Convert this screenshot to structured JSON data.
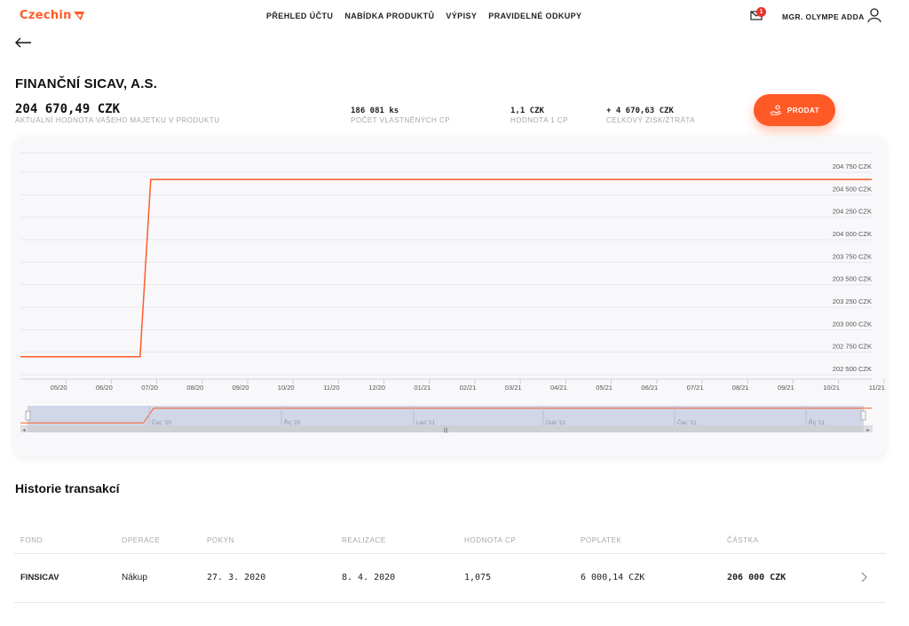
{
  "brand": {
    "name": "Czechin",
    "accent": "#ff5a26"
  },
  "nav": {
    "items": [
      "PŘEHLED ÚČTU",
      "NABÍDKA PRODUKTŮ",
      "VÝPISY",
      "PRAVIDELNÉ ODKUPY"
    ]
  },
  "header": {
    "mail_badge": "1",
    "user_name": "MGR. OLYMPE ADDA",
    "icons": [
      "mail-icon",
      "user-icon",
      "back-arrow-icon"
    ]
  },
  "product": {
    "title": "FINANČNÍ SICAV, A.S.",
    "value": "204 670,49 CZK",
    "value_label": "AKTUÁLNÍ HODNOTA VAŠEHO MAJETKU V PRODUKTU",
    "units": "186 081 ks",
    "units_label": "POČET VLASTNĚNÝCH CP",
    "unit_value": "1,1 CZK",
    "unit_value_label": "HODNOTA 1 CP",
    "profit": "+ 4 670,63 CZK",
    "profit_label": "CELKOVÝ ZISK/ZTRÁTA",
    "sell_label": "PRODAT"
  },
  "chart_data": {
    "type": "line",
    "title": "",
    "xlabel": "",
    "ylabel": "",
    "y_ticks": [
      "204 750 CZK",
      "204 500 CZK",
      "204 250 CZK",
      "204 000 CZK",
      "203 750 CZK",
      "203 500 CZK",
      "203 250 CZK",
      "203 000 CZK",
      "202 750 CZK",
      "202 500 CZK"
    ],
    "y_tick_values": [
      204750,
      204500,
      204250,
      204000,
      203750,
      203500,
      203250,
      203000,
      202750,
      202500
    ],
    "ylim": [
      202500,
      204750
    ],
    "x_ticks": [
      "05/20",
      "06/20",
      "07/20",
      "08/20",
      "09/20",
      "10/20",
      "11/20",
      "12/20",
      "01/21",
      "02/21",
      "03/21",
      "04/21",
      "05/21",
      "06/21",
      "07/21",
      "08/21",
      "09/21",
      "10/21",
      "11/21"
    ],
    "x": [
      "2020-04",
      "2020-06-20",
      "2020-06-27",
      "2021-11"
    ],
    "series": [
      {
        "values": [
          202700,
          202700,
          204670,
          204670
        ],
        "color": "#ff5a26"
      }
    ],
    "navigator": {
      "labels": [
        "Čec '20",
        "Říj '20",
        "Led '21",
        "Dub '21",
        "Čec '21",
        "Říj '21"
      ]
    },
    "grid": true
  },
  "history": {
    "title": "Historie transakcí",
    "headers": [
      "FOND",
      "OPERACE",
      "POKYN",
      "REALIZACE",
      "HODNOTA CP",
      "POPLATEK",
      "ČÁSTKA"
    ],
    "rows": [
      [
        "FINSICAV",
        "Nákup",
        "27. 3. 2020",
        "8. 4. 2020",
        "1,075",
        "6 000,14 CZK",
        "206 000 CZK"
      ]
    ]
  }
}
